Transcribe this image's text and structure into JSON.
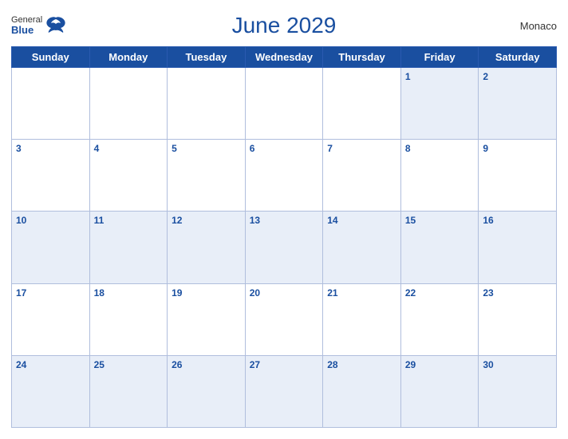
{
  "header": {
    "title": "June 2029",
    "country": "Monaco",
    "logo": {
      "general": "General",
      "blue": "Blue"
    }
  },
  "weekdays": [
    "Sunday",
    "Monday",
    "Tuesday",
    "Wednesday",
    "Thursday",
    "Friday",
    "Saturday"
  ],
  "weeks": [
    [
      null,
      null,
      null,
      null,
      null,
      1,
      2
    ],
    [
      3,
      4,
      5,
      6,
      7,
      8,
      9
    ],
    [
      10,
      11,
      12,
      13,
      14,
      15,
      16
    ],
    [
      17,
      18,
      19,
      20,
      21,
      22,
      23
    ],
    [
      24,
      25,
      26,
      27,
      28,
      29,
      30
    ]
  ]
}
